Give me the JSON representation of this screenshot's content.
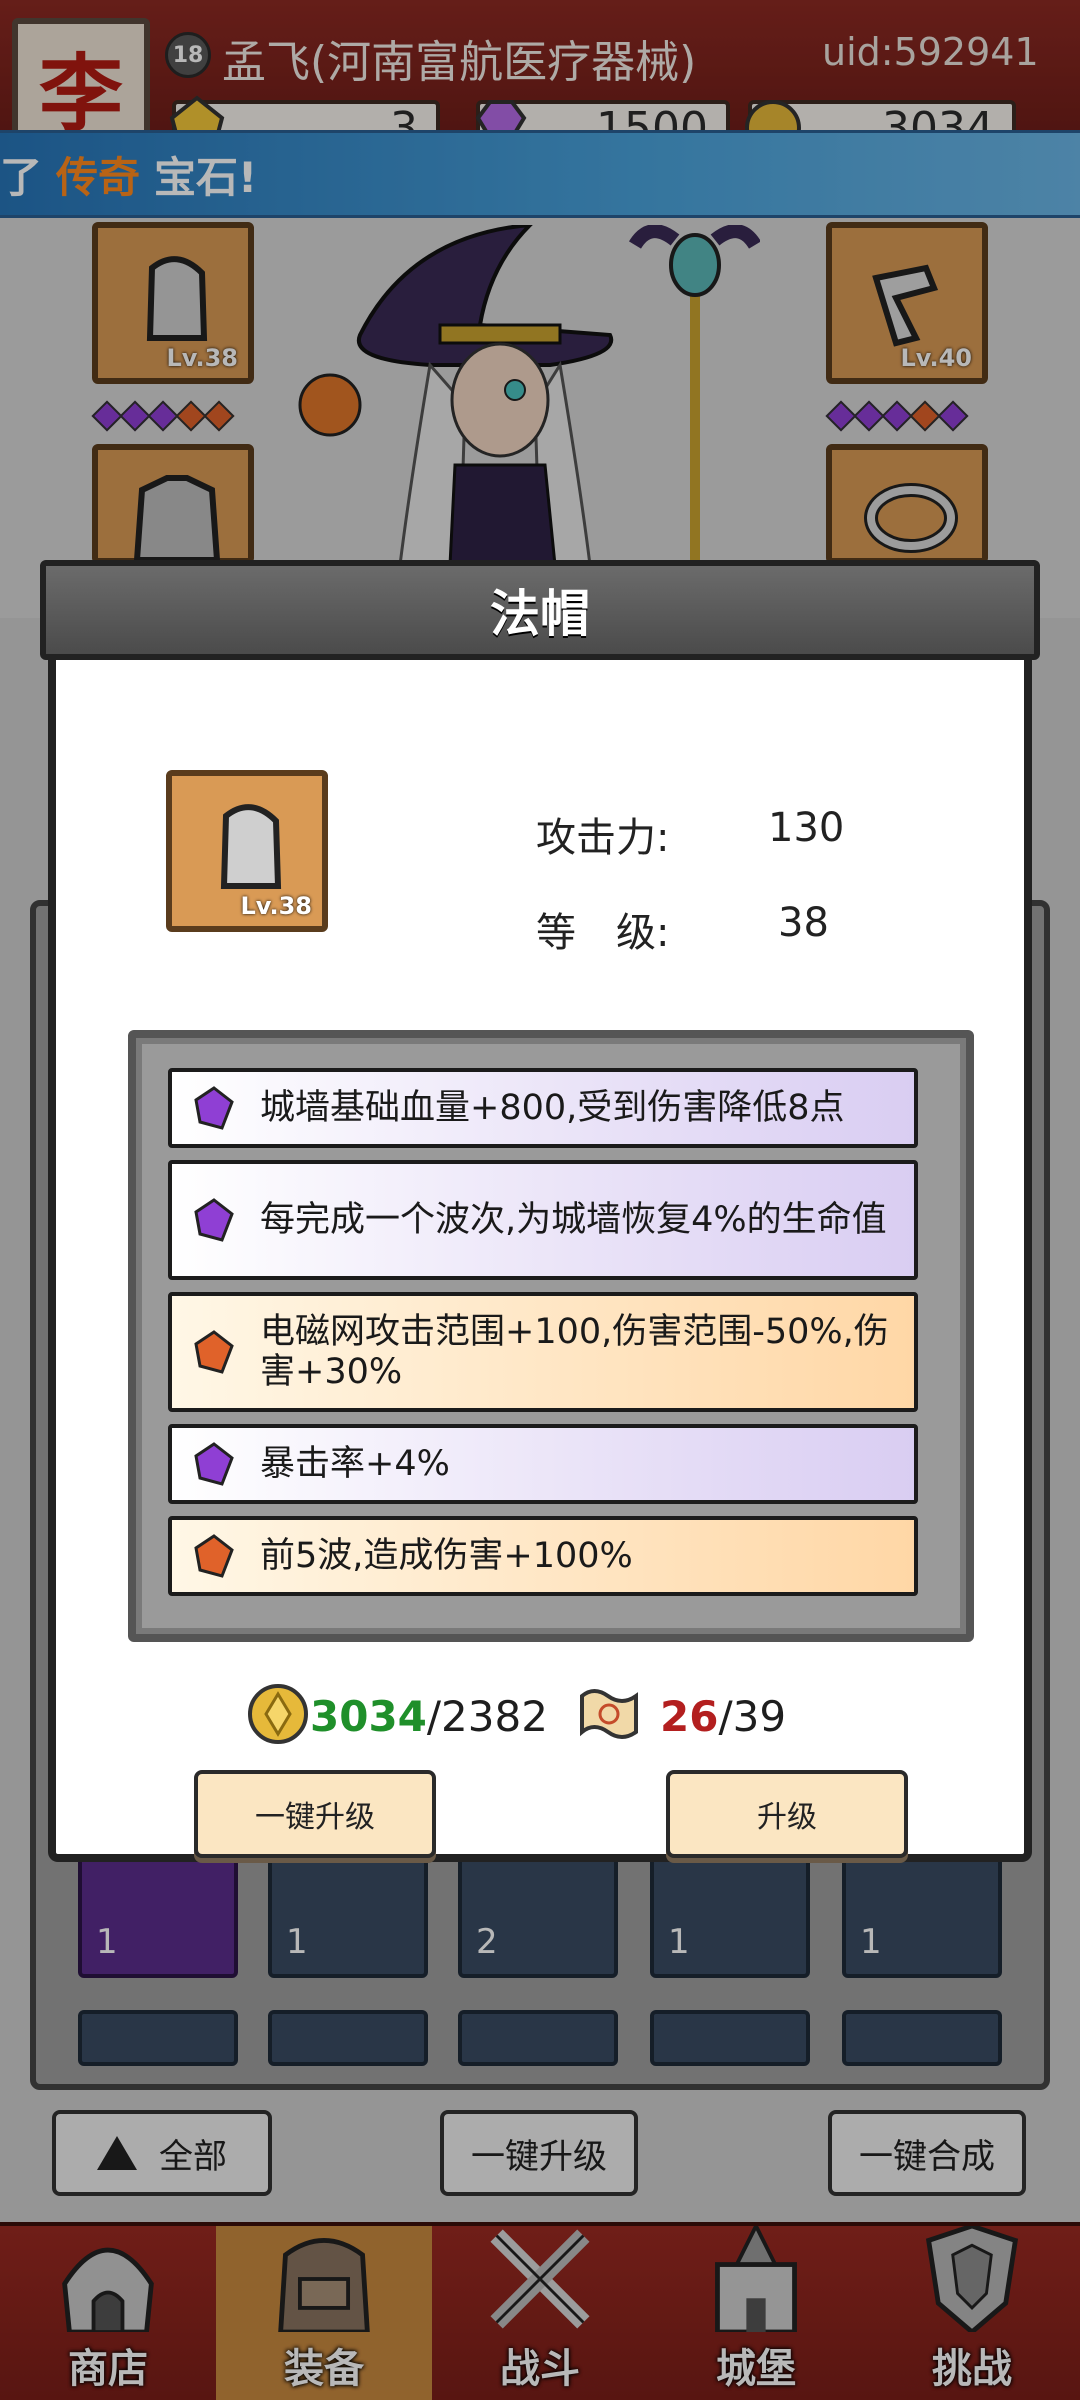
{
  "header": {
    "avatar_glyph": "李",
    "level": "18",
    "player_name": "孟飞(河南富航医疗器械)",
    "uid": "uid:592941",
    "resources": {
      "gold": "3",
      "gems": "1500",
      "coins": "3034"
    }
  },
  "marquee": {
    "prefix": "了",
    "highlight": "传奇",
    "suffix": "宝石!"
  },
  "equipment": {
    "left_top_level": "Lv.38",
    "right_top_level": "Lv.40"
  },
  "modal": {
    "title": "法帽",
    "item_level": "Lv.38",
    "attack_label": "攻击力:",
    "attack_value": "130",
    "level_label": "等　级:",
    "level_value": "38",
    "affixes": [
      {
        "text": "城墙基础血量+800,受到伤害降低8点",
        "rarity": "purple"
      },
      {
        "text": "每完成一个波次,为城墙恢复4%的生命值",
        "rarity": "purple"
      },
      {
        "text": "电磁网攻击范围+100,伤害范围-50%,伤害+30%",
        "rarity": "orange"
      },
      {
        "text": "暴击率+4%",
        "rarity": "purple"
      },
      {
        "text": "前5波,造成伤害+100%",
        "rarity": "orange"
      }
    ],
    "cost_gold_have": "3034",
    "cost_gold_need": "/2382",
    "cost_scroll_have": "26",
    "cost_scroll_need": "/39",
    "btn_one_key_upgrade": "一键升级",
    "btn_upgrade": "升级"
  },
  "inventory": {
    "counts": [
      "1",
      "1",
      "2",
      "1",
      "1"
    ]
  },
  "bottom_actions": {
    "all": "全部",
    "one_key_upgrade": "一键升级",
    "one_key_merge": "一键合成"
  },
  "nav": {
    "shop": "商店",
    "equipment": "装备",
    "battle": "战斗",
    "castle": "城堡",
    "challenge": "挑战"
  },
  "colors": {
    "header_red": "#8d2a23",
    "marquee_blue": "#3a8fd0",
    "purple_gem": "#8f3fd4",
    "orange_gem": "#e0622a",
    "have_green": "#1f8f2a",
    "have_red": "#b31f1f"
  }
}
